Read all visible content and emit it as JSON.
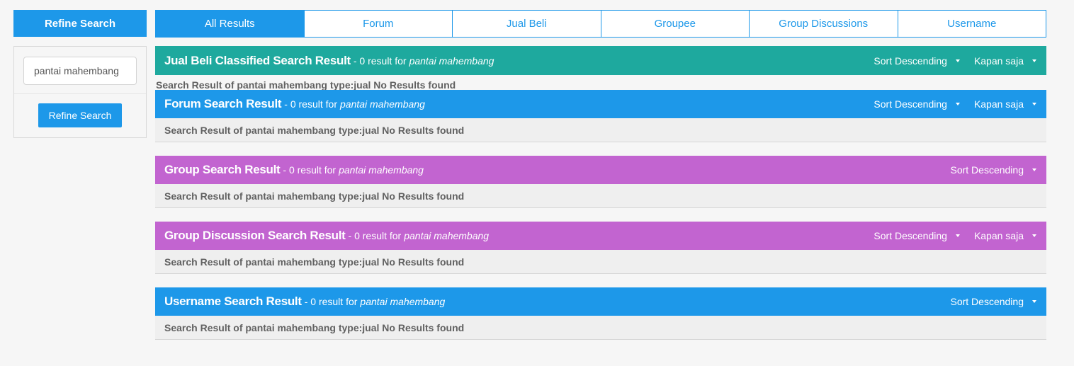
{
  "sidebar": {
    "header": "Refine Search",
    "input_value": "pantai mahembang",
    "button_label": "Refine Search"
  },
  "tabs": [
    {
      "label": "All Results",
      "active": true
    },
    {
      "label": "Forum",
      "active": false
    },
    {
      "label": "Jual Beli",
      "active": false
    },
    {
      "label": "Groupee",
      "active": false
    },
    {
      "label": "Group Discussions",
      "active": false
    },
    {
      "label": "Username",
      "active": false
    }
  ],
  "sections": [
    {
      "title": "Jual Beli Classified Search Result",
      "count_text": "- 0 result for",
      "query": "pantai mahembang",
      "sort_label": "Sort Descending",
      "time_label": "Kapan saja",
      "message": "Search Result of pantai mahembang type:jual No Results found",
      "color": "#1ea99e"
    },
    {
      "title": "Forum Search Result",
      "count_text": "- 0 result for",
      "query": "pantai mahembang",
      "sort_label": "Sort Descending",
      "time_label": "Kapan saja",
      "message": "Search Result of pantai mahembang type:jual No Results found",
      "color": "#1d98e9"
    },
    {
      "title": "Group Search Result",
      "count_text": "- 0 result for",
      "query": "pantai mahembang",
      "sort_label": "Sort Descending",
      "message": "Search Result of pantai mahembang type:jual No Results found",
      "color": "#c264d0"
    },
    {
      "title": "Group Discussion Search Result",
      "count_text": "- 0 result for",
      "query": "pantai mahembang",
      "sort_label": "Sort Descending",
      "time_label": "Kapan saja",
      "message": "Search Result of pantai mahembang type:jual No Results found",
      "color": "#c264d0"
    },
    {
      "title": "Username Search Result",
      "count_text": "- 0 result for",
      "query": "pantai mahembang",
      "sort_label": "Sort Descending",
      "message": "Search Result of pantai mahembang type:jual No Results found",
      "color": "#1d98e9"
    }
  ],
  "icons": {
    "dropdown": "caret-down-icon"
  }
}
